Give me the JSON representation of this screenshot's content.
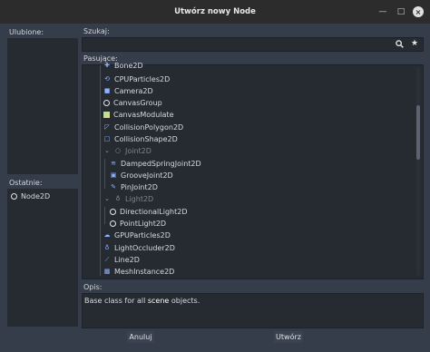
{
  "window": {
    "title": "Utwórz nowy Node"
  },
  "favorites": {
    "label": "Ulubione:"
  },
  "recent": {
    "label": "Ostatnie:",
    "items": [
      {
        "label": "Node2D",
        "icon": "circle-icon"
      }
    ]
  },
  "search": {
    "label": "Szukaj:",
    "value": "",
    "placeholder": ""
  },
  "matches": {
    "label": "Pasujące:",
    "items": [
      {
        "label": "Bone2D",
        "icon": "bone-icon"
      },
      {
        "label": "CPUParticles2D",
        "icon": "cpu-particles-icon"
      },
      {
        "label": "Camera2D",
        "icon": "camera-icon"
      },
      {
        "label": "CanvasGroup",
        "icon": "circle-icon"
      },
      {
        "label": "CanvasModulate",
        "icon": "canvas-modulate-icon"
      },
      {
        "label": "CollisionPolygon2D",
        "icon": "collision-polygon-icon"
      },
      {
        "label": "CollisionShape2D",
        "icon": "collision-shape-icon"
      },
      {
        "label": "Joint2D",
        "icon": "joint-icon",
        "disabled": true
      },
      {
        "label": "DampedSpringJoint2D",
        "icon": "spring-icon"
      },
      {
        "label": "GrooveJoint2D",
        "icon": "groove-icon"
      },
      {
        "label": "PinJoint2D",
        "icon": "pin-icon"
      },
      {
        "label": "Light2D",
        "icon": "light-icon",
        "disabled": true
      },
      {
        "label": "DirectionalLight2D",
        "icon": "circle-icon"
      },
      {
        "label": "PointLight2D",
        "icon": "circle-icon"
      },
      {
        "label": "GPUParticles2D",
        "icon": "gpu-particles-icon"
      },
      {
        "label": "LightOccluder2D",
        "icon": "light-occluder-icon"
      },
      {
        "label": "Line2D",
        "icon": "line-icon"
      },
      {
        "label": "MeshInstance2D",
        "icon": "mesh-icon"
      }
    ]
  },
  "description": {
    "label": "Opis:",
    "text_prefix": "Base class for all ",
    "text_highlight": "scene",
    "text_suffix": " objects."
  },
  "buttons": {
    "cancel": "Anuluj",
    "create": "Utwórz"
  },
  "colors": {
    "accent_blue": "#8eb4ff",
    "accent_green": "#9ee3a5",
    "accent_red": "#f27b7b"
  }
}
